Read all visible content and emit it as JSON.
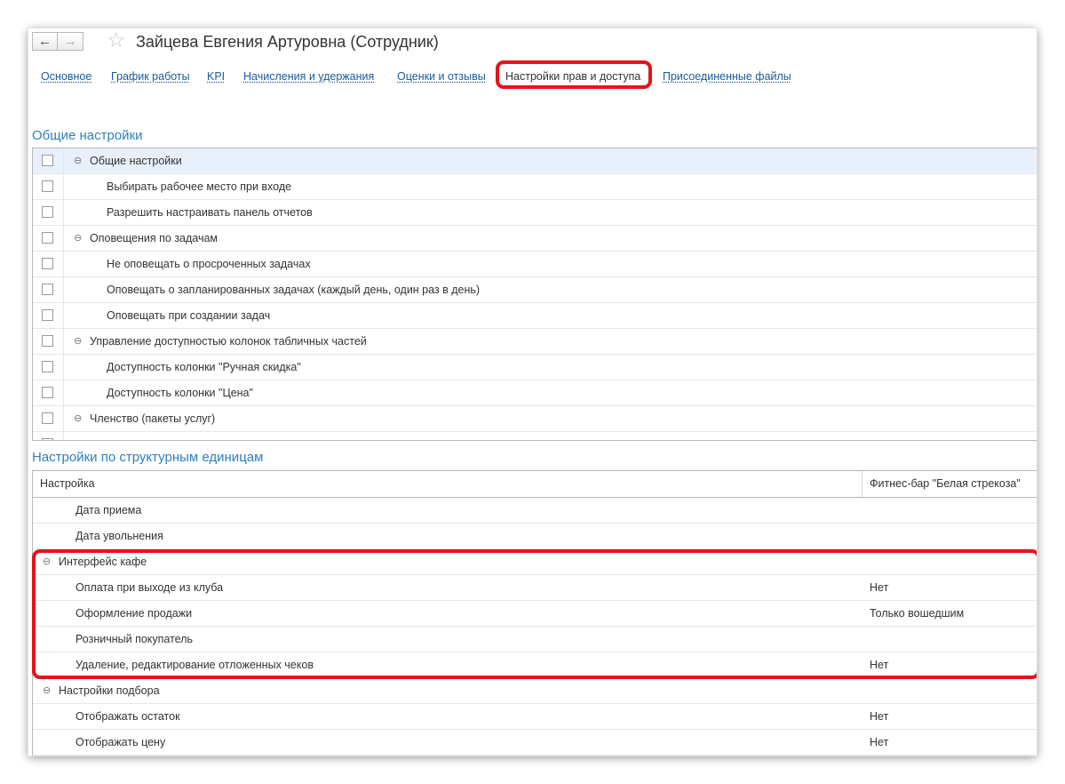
{
  "window": {
    "title": "Зайцева Евгения Артуровна (Сотрудник)",
    "nav": {
      "back_icon": "←",
      "forward_icon": "→",
      "star_icon": "☆"
    }
  },
  "tabs": [
    {
      "label": "Основное",
      "active": false
    },
    {
      "label": "График работы",
      "active": false
    },
    {
      "label": "KPI",
      "active": false
    },
    {
      "label": "Начисления и удержания",
      "active": false
    },
    {
      "label": "Оценки и отзывы",
      "active": false
    },
    {
      "label": "Настройки прав и доступа",
      "active": true
    },
    {
      "label": "Присоединенные файлы",
      "active": false
    }
  ],
  "general": {
    "title": "Общие настройки",
    "rows": [
      {
        "label": "Общие настройки",
        "level": 0,
        "group": true,
        "checked": false
      },
      {
        "label": "Выбирать рабочее место при входе",
        "level": 1,
        "group": false,
        "checked": false
      },
      {
        "label": "Разрешить настраивать панель отчетов",
        "level": 1,
        "group": false,
        "checked": false
      },
      {
        "label": "Оповещения по задачам",
        "level": 0,
        "group": true,
        "checked": false
      },
      {
        "label": "Не оповещать о просроченных задачах",
        "level": 1,
        "group": false,
        "checked": false
      },
      {
        "label": "Оповещать о запланированных задачах (каждый день, один раз в день)",
        "level": 1,
        "group": false,
        "checked": false
      },
      {
        "label": "Оповещать при создании задач",
        "level": 1,
        "group": false,
        "checked": false
      },
      {
        "label": "Управление доступностью колонок табличных частей",
        "level": 0,
        "group": true,
        "checked": false
      },
      {
        "label": "Доступность колонки \"Ручная скидка\"",
        "level": 1,
        "group": false,
        "checked": false
      },
      {
        "label": "Доступность колонки \"Цена\"",
        "level": 1,
        "group": false,
        "checked": false
      },
      {
        "label": "Членство (пакеты услуг)",
        "level": 0,
        "group": true,
        "checked": false
      }
    ]
  },
  "units": {
    "title": "Настройки по структурным единицам",
    "col_setting": "Настройка",
    "col_unit": "Фитнес-бар \"Белая стрекоза\"",
    "rows": [
      {
        "label": "Дата приема",
        "level": 1,
        "group": false,
        "value": ""
      },
      {
        "label": "Дата увольнения",
        "level": 1,
        "group": false,
        "value": ""
      },
      {
        "label": "Интерфейс кафе",
        "level": 0,
        "group": true,
        "value": ""
      },
      {
        "label": "Оплата при выходе из клуба",
        "level": 1,
        "group": false,
        "value": "Нет"
      },
      {
        "label": "Оформление продажи",
        "level": 1,
        "group": false,
        "value": "Только вошедшим"
      },
      {
        "label": "Розничный покупатель",
        "level": 1,
        "group": false,
        "value": ""
      },
      {
        "label": "Удаление, редактирование отложенных чеков",
        "level": 1,
        "group": false,
        "value": "Нет"
      },
      {
        "label": "Настройки подбора",
        "level": 0,
        "group": true,
        "value": ""
      },
      {
        "label": "Отображать остаток",
        "level": 1,
        "group": false,
        "value": "Нет"
      },
      {
        "label": "Отображать цену",
        "level": 1,
        "group": false,
        "value": "Нет"
      }
    ]
  },
  "colors": {
    "accent": "#2d7fbe",
    "link": "#1a5b9c",
    "highlight_frame": "#e3151c"
  },
  "collapse_icon": "⊖"
}
